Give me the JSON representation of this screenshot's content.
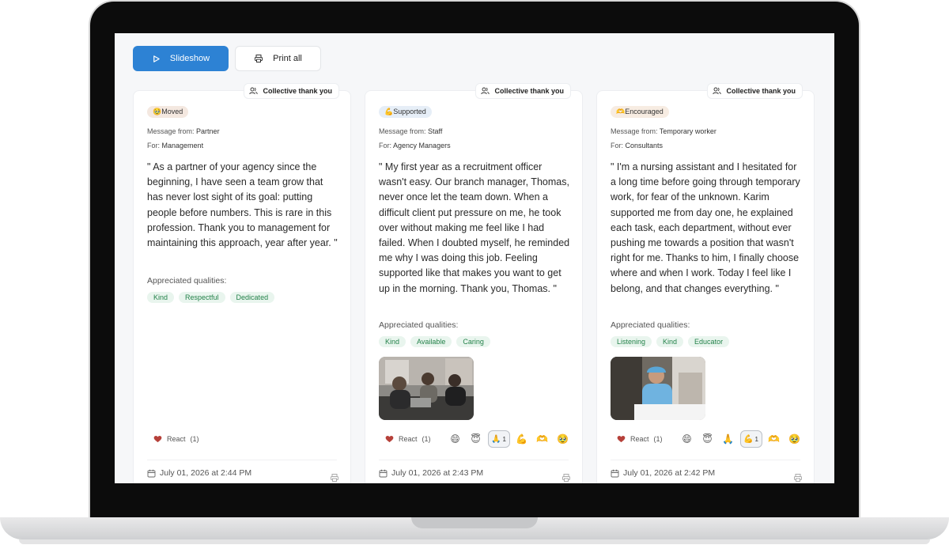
{
  "toolbar": {
    "slideshow_label": "Slideshow",
    "print_all_label": "Print all"
  },
  "collective_label": "Collective thank you",
  "message_from_prefix": "Message from:",
  "for_prefix": "For:",
  "qualities_label": "Appreciated qualities:",
  "react_label": "React",
  "cards": [
    {
      "mood": "🥹Moved",
      "mood_color": "#f4e8e0",
      "from": "Partner",
      "for": "Management",
      "message": "\" As a partner of your agency since the beginning, I have seen a team grow that has never lost sight of its goal: putting people before numbers. This is rare in this profession. Thank you to management for maintaining this approach, year after year. \"",
      "qualities": [
        "Kind",
        "Respectful",
        "Dedicated"
      ],
      "react_count": "(1)",
      "date": "July 01, 2026 at 2:44 PM"
    },
    {
      "mood": "💪Supported",
      "mood_color": "#e6eef7",
      "from": "Staff",
      "for": "Agency Managers",
      "message": "\" My first year as a recruitment officer wasn't easy. Our branch manager, Thomas, never once let the team down. When a difficult client put pressure on me, he took over without making me feel like I had failed. When I doubted myself, he reminded me why I was doing this job. Feeling supported like that makes you want to get up in the morning. Thank you, Thomas. \"",
      "qualities": [
        "Kind",
        "Available",
        "Caring"
      ],
      "react_count": "(1)",
      "selected_count": "1",
      "date": "July 01, 2026 at 2:43 PM"
    },
    {
      "mood": "🫶Encouraged",
      "mood_color": "#f7ece2",
      "from": "Temporary worker",
      "for": "Consultants",
      "message": "\" I'm a nursing assistant and I hesitated for a long time before going through temporary work, for fear of the unknown. Karim supported me from day one, he explained each task, each department, without ever pushing me towards a position that wasn't right for me. Thanks to him, I finally choose where and when I work. Today I feel like I belong, and that changes everything. \"",
      "qualities": [
        "Listening",
        "Kind",
        "Educator"
      ],
      "react_count": "(1)",
      "selected_count": "1",
      "date": "July 01, 2026 at 2:42 PM"
    }
  ],
  "emojis": [
    "😄",
    "😇",
    "🙏",
    "💪",
    "🫶",
    "🥹"
  ],
  "icons": [
    "play-icon",
    "printer-icon",
    "users-icon",
    "heart-icon",
    "calendar-icon"
  ]
}
